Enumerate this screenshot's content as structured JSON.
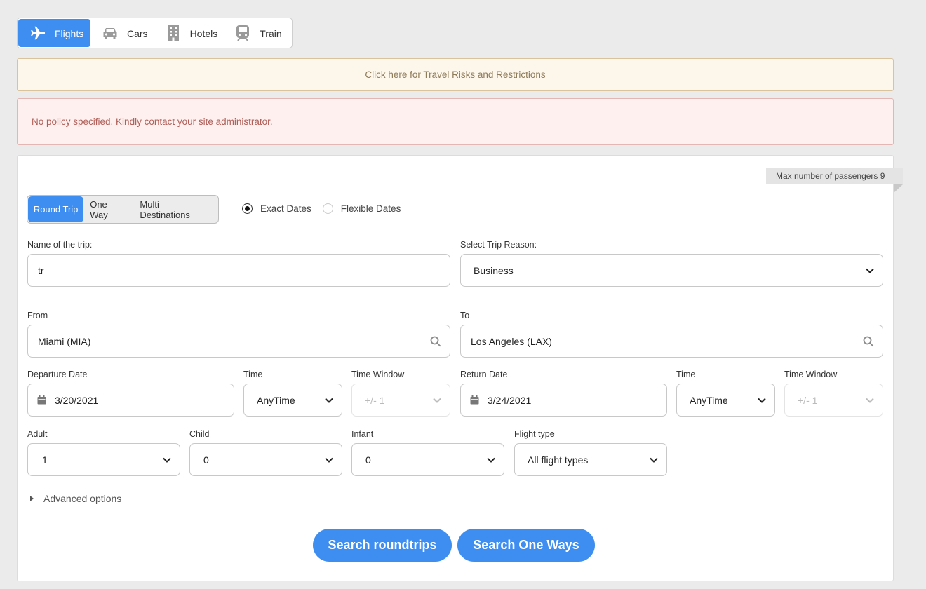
{
  "product_tabs": [
    {
      "label": "Flights",
      "icon": "plane-icon",
      "active": true
    },
    {
      "label": "Cars",
      "icon": "car-icon",
      "active": false
    },
    {
      "label": "Hotels",
      "icon": "building-icon",
      "active": false
    },
    {
      "label": "Train",
      "icon": "train-icon",
      "active": false
    }
  ],
  "alerts": {
    "travel_risks": "Click here for Travel Risks and Restrictions",
    "policy": "No policy specified. Kindly contact your site administrator."
  },
  "search": {
    "max_passengers": "Max number of passengers 9",
    "trip_types": [
      {
        "label": "Round Trip",
        "active": true
      },
      {
        "label": "One Way",
        "active": false
      },
      {
        "label": "Multi Destinations",
        "active": false
      }
    ],
    "date_modes": [
      {
        "label": "Exact Dates",
        "checked": true
      },
      {
        "label": "Flexible Dates",
        "checked": false
      }
    ],
    "trip_name": {
      "label": "Name of the trip:",
      "value": "tr"
    },
    "trip_reason": {
      "label": "Select Trip Reason:",
      "value": "Business"
    },
    "from": {
      "label": "From",
      "value": "Miami (MIA)"
    },
    "to": {
      "label": "To",
      "value": "Los Angeles (LAX)"
    },
    "departure": {
      "date_label": "Departure Date",
      "date_value": "3/20/2021",
      "time_label": "Time",
      "time_value": "AnyTime",
      "window_label": "Time Window",
      "window_value": "+/- 1"
    },
    "return": {
      "date_label": "Return Date",
      "date_value": "3/24/2021",
      "time_label": "Time",
      "time_value": "AnyTime",
      "window_label": "Time Window",
      "window_value": "+/- 1"
    },
    "adult": {
      "label": "Adult",
      "value": "1"
    },
    "child": {
      "label": "Child",
      "value": "0"
    },
    "infant": {
      "label": "Infant",
      "value": "0"
    },
    "flight_type": {
      "label": "Flight type",
      "value": "All flight types"
    },
    "advanced_options": "Advanced options",
    "search_roundtrips": "Search roundtrips",
    "search_one_ways": "Search One Ways"
  },
  "colors": {
    "accent": "#3d8ef0",
    "page_bg": "#ebebeb",
    "risk_bg": "#fdf6ea",
    "policy_bg": "#fdf0ef",
    "policy_text": "#b05e57"
  }
}
